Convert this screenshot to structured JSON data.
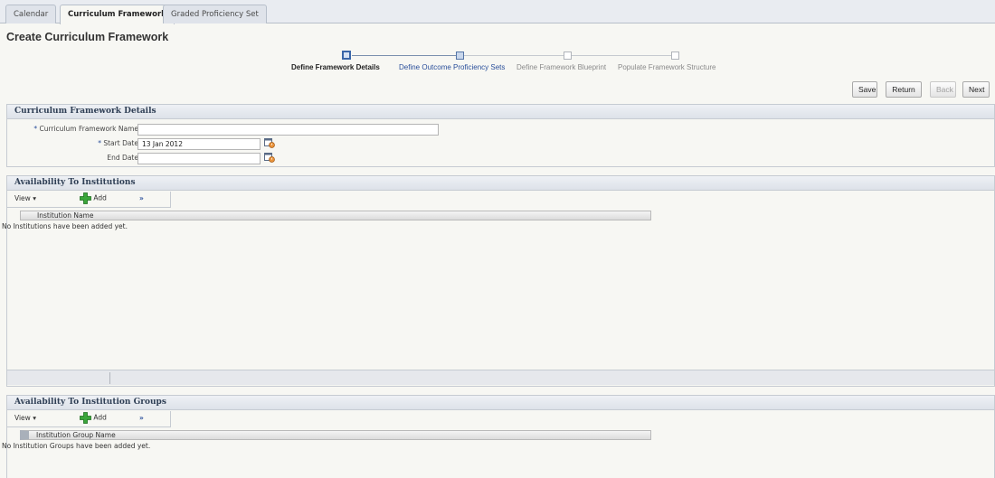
{
  "tabs": [
    {
      "label": "Calendar"
    },
    {
      "label": "Curriculum Framework"
    },
    {
      "label": "Graded Proficiency Set"
    }
  ],
  "page_title": "Create Curriculum Framework",
  "train": {
    "steps": [
      {
        "label": "Define Framework Details",
        "state": "current"
      },
      {
        "label": "Define Outcome Proficiency Sets",
        "state": "visited"
      },
      {
        "label": "Define Framework Blueprint",
        "state": "disabled"
      },
      {
        "label": "Populate Framework Structure",
        "state": "disabled"
      }
    ]
  },
  "actions": {
    "save": "Save",
    "return": "Return",
    "back": "Back",
    "next": "Next"
  },
  "details": {
    "header": "Curriculum Framework Details",
    "fields": {
      "name_label": "Curriculum Framework Name",
      "name_value": "",
      "start_label": "Start Date",
      "start_value": "13 Jan 2012",
      "end_label": "End Date",
      "end_value": "",
      "required_marker": "*"
    }
  },
  "institutions": {
    "header": "Availability To Institutions",
    "view": "View",
    "add": "Add",
    "more": "»",
    "column": "Institution Name",
    "empty": "No Institutions have been added yet."
  },
  "groups": {
    "header": "Availability To Institution Groups",
    "view": "View",
    "add": "Add",
    "more": "»",
    "column": "Institution Group Name",
    "empty": "No Institution Groups have been added yet."
  },
  "colors": {
    "accent": "#2a4f9b",
    "add_icon": "#3aa63a"
  }
}
